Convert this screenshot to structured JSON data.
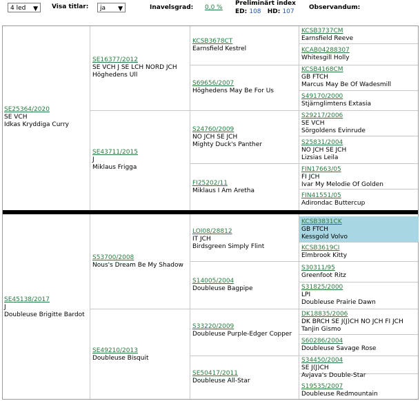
{
  "toolbar": {
    "generations_value": "4 led",
    "titles_label": "Visa titlar:",
    "titles_value": "ja",
    "inbreeding_label": "Inavelsgrad:",
    "inbreeding_value": "0,0 %",
    "prelim_label": "Preliminärt index",
    "ed_label": "ED:",
    "ed_value": "108",
    "hd_label": "HD:",
    "hd_value": "107",
    "observandum_label": "Observandum:"
  },
  "pedigree": {
    "sire": {
      "reg": "SE25364/2020",
      "titles": "SE VCH",
      "name": "Idkas Kryddiga Curry"
    },
    "dam": {
      "reg": "SE45138/2017",
      "titles": "J",
      "name": "Doubleuse Brigitte Bardot"
    },
    "ss": {
      "reg": "SE16377/2012",
      "titles": "SE VCH J SE LCH NORD JCH",
      "name": "Höghedens Ull"
    },
    "sd": {
      "reg": "SE43711/2015",
      "titles": "J",
      "name": "Miklaus Frigga"
    },
    "ds": {
      "reg": "S53700/2008",
      "titles": "",
      "name": "Nous's Dream Be My Shadow"
    },
    "dd": {
      "reg": "SE49210/2013",
      "titles": "",
      "name": "Doubleuse Bisquit"
    },
    "g3": [
      {
        "reg": "KCSB3678CT",
        "titles": "",
        "name": "Earnsfield Kestrel"
      },
      {
        "reg": "S69656/2007",
        "titles": "",
        "name": "Höghedens May Be For Us"
      },
      {
        "reg": "S24760/2009",
        "titles": "NO JCH SE JCH",
        "name": "Mighty Duck's Panther"
      },
      {
        "reg": "FI25202/11",
        "titles": "",
        "name": "Miklaus I Am Aretha"
      },
      {
        "reg": "LOI08/28812",
        "titles": "IT JCH",
        "name": "Birdsgreen Simply Flint"
      },
      {
        "reg": "S14005/2004",
        "titles": "",
        "name": "Doubleuse Bagpipe"
      },
      {
        "reg": "S33220/2009",
        "titles": "",
        "name": "Doubleuse Purple-Edger Copper"
      },
      {
        "reg": "SE50417/2011",
        "titles": "",
        "name": "Doubleuse All-Star"
      }
    ],
    "g4": [
      {
        "reg": "KCSB3737CM",
        "titles": "",
        "name": "Earnsfield Reeve"
      },
      {
        "reg": "KCAB04288307",
        "titles": "",
        "name": "Whitesgill Holly"
      },
      {
        "reg": "KCSB4168CM",
        "titles": "GB FTCH",
        "name": "Marcus May Be Of Wadesmill"
      },
      {
        "reg": "S49170/2000",
        "titles": "",
        "name": "Stjärnglimtens Extasia"
      },
      {
        "reg": "S29217/2006",
        "titles": "SE VCH",
        "name": "Sörgoldens Evinrude"
      },
      {
        "reg": "S25831/2004",
        "titles": "NO JCH SE JCH",
        "name": "Lizsias Leila"
      },
      {
        "reg": "FIN17663/05",
        "titles": "FI JCH",
        "name": "Ivar My Melodie Of Golden"
      },
      {
        "reg": "FIN41551/05",
        "titles": "",
        "name": "Adirondac Buttercup"
      },
      {
        "reg": "KCSB3831CK",
        "titles": "GB FTCH",
        "name": "Kessgold Volvo"
      },
      {
        "reg": "KCSB3619CI",
        "titles": "",
        "name": "Elmbrook Kitty"
      },
      {
        "reg": "S30311/95",
        "titles": "",
        "name": "Greenfoot Ritz"
      },
      {
        "reg": "S31825/2000",
        "titles": "LPI",
        "name": "Doubleuse Prairie Dawn"
      },
      {
        "reg": "DK18835/2006",
        "titles": "DK BRCH SE J(J)CH NO JCH FI JCH",
        "name": "Tanjin Gismo"
      },
      {
        "reg": "S60286/2004",
        "titles": "",
        "name": "Doubleuse Savage Rose"
      },
      {
        "reg": "S34450/2004",
        "titles": "SE J(J)CH",
        "name": "Avjava's Double-Star"
      },
      {
        "reg": "S19535/2007",
        "titles": "",
        "name": "Doubleuse Redmountain"
      }
    ]
  }
}
